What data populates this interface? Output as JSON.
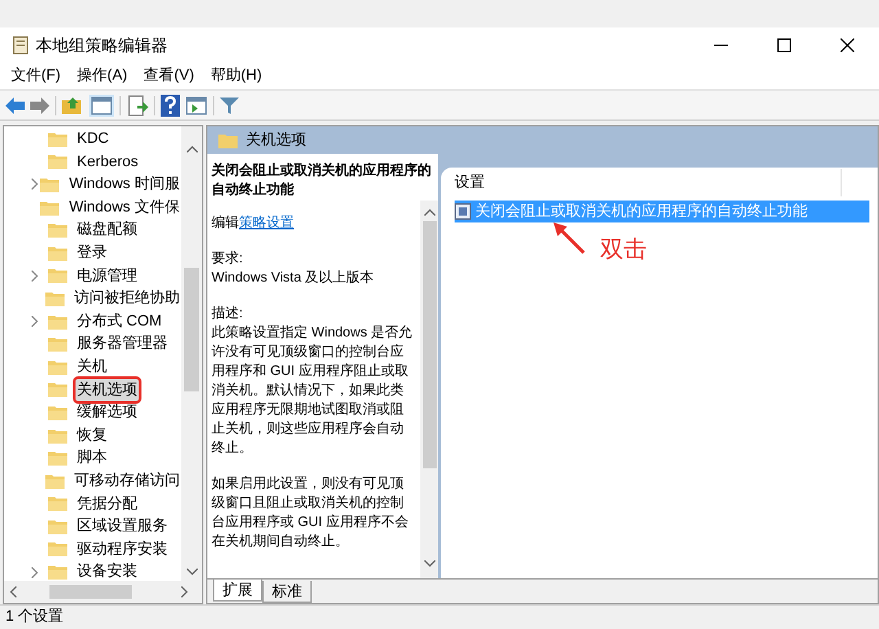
{
  "window": {
    "title": "本地组策略编辑器"
  },
  "menu": [
    "文件(F)",
    "操作(A)",
    "查看(V)",
    "帮助(H)"
  ],
  "tree": {
    "items": [
      {
        "label": "KDC",
        "expandable": false,
        "selected": false
      },
      {
        "label": "Kerberos",
        "expandable": false,
        "selected": false
      },
      {
        "label": "Windows 时间服",
        "expandable": true,
        "selected": false
      },
      {
        "label": "Windows 文件保",
        "expandable": false,
        "selected": false
      },
      {
        "label": "磁盘配额",
        "expandable": false,
        "selected": false
      },
      {
        "label": "登录",
        "expandable": false,
        "selected": false
      },
      {
        "label": "电源管理",
        "expandable": true,
        "selected": false
      },
      {
        "label": "访问被拒绝协助",
        "expandable": false,
        "selected": false
      },
      {
        "label": "分布式 COM",
        "expandable": true,
        "selected": false
      },
      {
        "label": "服务器管理器",
        "expandable": false,
        "selected": false
      },
      {
        "label": "关机",
        "expandable": false,
        "selected": false
      },
      {
        "label": "关机选项",
        "expandable": false,
        "selected": true
      },
      {
        "label": "缓解选项",
        "expandable": false,
        "selected": false
      },
      {
        "label": "恢复",
        "expandable": false,
        "selected": false
      },
      {
        "label": "脚本",
        "expandable": false,
        "selected": false
      },
      {
        "label": "可移动存储访问",
        "expandable": false,
        "selected": false
      },
      {
        "label": "凭据分配",
        "expandable": false,
        "selected": false
      },
      {
        "label": "区域设置服务",
        "expandable": false,
        "selected": false
      },
      {
        "label": "驱动程序安装",
        "expandable": false,
        "selected": false
      },
      {
        "label": "设备安装",
        "expandable": true,
        "selected": false
      }
    ]
  },
  "header": {
    "title": "关机选项"
  },
  "description": {
    "title": "关闭会阻止或取消关机的应用程序的自动终止功能",
    "edit_prefix": "编辑",
    "edit_link": "策略设置",
    "requirements_label": "要求:",
    "requirements": "Windows Vista 及以上版本",
    "description_label": "描述:",
    "paragraphs": [
      "此策略设置指定 Windows 是否允许没有可见顶级窗口的控制台应用程序和 GUI 应用程序阻止或取消关机。默认情况下，如果此类应用程序无限期地试图取消或阻止关机，则这些应用程序会自动终止。",
      "如果启用此设置，则没有可见顶级窗口且阻止或取消关机的控制台应用程序或 GUI 应用程序不会在关机期间自动终止。"
    ]
  },
  "settings": {
    "column": "设置",
    "rows": [
      {
        "label": "关闭会阻止或取消关机的应用程序的自动终止功能",
        "selected": true
      }
    ]
  },
  "tabs": [
    {
      "label": "扩展",
      "selected": true
    },
    {
      "label": "标准",
      "selected": false
    }
  ],
  "annotation": {
    "text": "双击"
  },
  "status_bar": "1 个设置"
}
